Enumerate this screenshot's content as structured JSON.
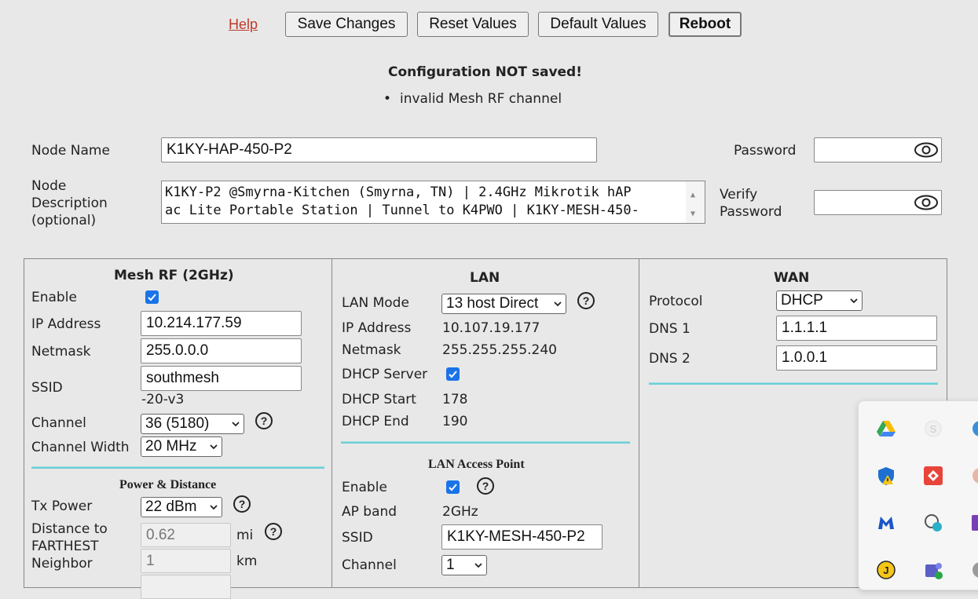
{
  "toolbar": {
    "help": "Help",
    "save": "Save Changes",
    "reset": "Reset Values",
    "default": "Default Values",
    "reboot": "Reboot"
  },
  "error": {
    "title": "Configuration NOT saved!",
    "items": [
      "invalid Mesh RF channel"
    ]
  },
  "node": {
    "name_label": "Node Name",
    "name_value": "K1KY-HAP-450-P2",
    "desc_label_1": "Node",
    "desc_label_2": "Description",
    "desc_label_3": "(optional)",
    "desc_line1": "K1KY-P2 @Smyrna-Kitchen (Smyrna, TN) | 2.4GHz Mikrotik hAP",
    "desc_line2": "ac Lite Portable Station | Tunnel to K4PWO | K1KY-MESH-450-",
    "password_label": "Password",
    "verify_label_1": "Verify",
    "verify_label_2": "Password"
  },
  "mesh": {
    "title": "Mesh RF (2GHz)",
    "enable_label": "Enable",
    "enabled": true,
    "ip_label": "IP Address",
    "ip_value": "10.214.177.59",
    "netmask_label": "Netmask",
    "netmask_value": "255.0.0.0",
    "ssid_label": "SSID",
    "ssid_value": "southmesh",
    "ssid_suffix": "-20-v3",
    "channel_label": "Channel",
    "channel_value": "36 (5180)",
    "width_label": "Channel Width",
    "width_value": "20 MHz",
    "power_title": "Power & Distance",
    "txpower_label": "Tx Power",
    "txpower_value": "22 dBm",
    "distance_label_1": "Distance to",
    "distance_label_2": "FARTHEST",
    "distance_label_3": "Neighbor",
    "distance_mi": "0.62",
    "distance_km": "1",
    "unit_mi": "mi",
    "unit_km": "km"
  },
  "lan": {
    "title": "LAN",
    "mode_label": "LAN Mode",
    "mode_value": "13 host Direct",
    "ip_label": "IP Address",
    "ip_value": "10.107.19.177",
    "netmask_label": "Netmask",
    "netmask_value": "255.255.255.240",
    "dhcp_label": "DHCP Server",
    "dhcp_enabled": true,
    "dhcp_start_label": "DHCP Start",
    "dhcp_start_value": "178",
    "dhcp_end_label": "DHCP End",
    "dhcp_end_value": "190",
    "ap_title": "LAN Access Point",
    "ap_enable_label": "Enable",
    "ap_enabled": true,
    "ap_band_label": "AP band",
    "ap_band_value": "2GHz",
    "ap_ssid_label": "SSID",
    "ap_ssid_value": "K1KY-MESH-450-P2",
    "ap_channel_label": "Channel",
    "ap_channel_value": "1"
  },
  "wan": {
    "title": "WAN",
    "protocol_label": "Protocol",
    "protocol_value": "DHCP",
    "dns1_label": "DNS 1",
    "dns1_value": "1.1.1.1",
    "dns2_label": "DNS 2",
    "dns2_value": "1.0.0.1"
  },
  "help_glyph": "?",
  "colors": {
    "accent": "#1a73e8",
    "divider": "#6ccfd6",
    "help_link": "#c0392b"
  }
}
